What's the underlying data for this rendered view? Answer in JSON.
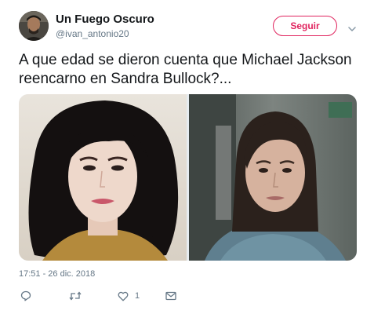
{
  "tweet": {
    "author_name": "Un Fuego Oscuro",
    "author_handle": "@ivan_antonio20",
    "follow_label": "Seguir",
    "text": "A que edad se dieron cuenta que Michael Jackson reencarno en Sandra Bullock?...",
    "timestamp": "17:51 - 26 dic. 2018",
    "like_count": "1"
  },
  "colors": {
    "follow_accent": "#e0245e",
    "secondary_text": "#657786",
    "primary_text": "#14171a"
  },
  "icons": {
    "reply": "reply-icon",
    "retweet": "retweet-icon",
    "like": "heart-icon",
    "message": "envelope-icon",
    "more": "chevron-down-icon"
  }
}
